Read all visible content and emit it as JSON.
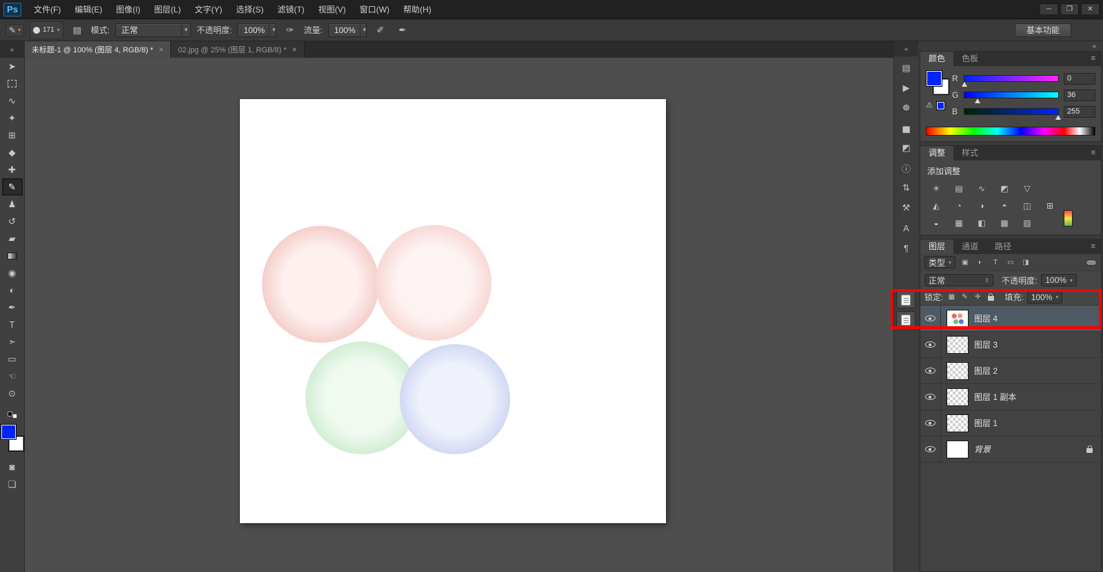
{
  "menubar": {
    "logo": "Ps",
    "items": [
      "文件(F)",
      "编辑(E)",
      "图像(I)",
      "图层(L)",
      "文字(Y)",
      "选择(S)",
      "滤镜(T)",
      "视图(V)",
      "窗口(W)",
      "帮助(H)"
    ],
    "window_controls": {
      "minimize": "─",
      "restore": "❐",
      "close": "✕"
    }
  },
  "options_bar": {
    "brush_size": "171",
    "mode_label": "模式:",
    "mode_value": "正常",
    "opacity_label": "不透明度:",
    "opacity_value": "100%",
    "flow_label": "流量:",
    "flow_value": "100%",
    "workspace_button": "基本功能"
  },
  "document_tabs": [
    {
      "title": "未标题-1 @ 100% (图层 4, RGB/8) *",
      "close": "×"
    },
    {
      "title": "02.jpg @ 25% (图层 1, RGB/8) *",
      "close": "×"
    }
  ],
  "toolbar": {
    "expand_icon": "»",
    "tools": [
      {
        "name": "move-tool",
        "glyph": "➤"
      },
      {
        "name": "rectangular-marquee-tool",
        "glyph": ""
      },
      {
        "name": "lasso-tool",
        "glyph": "∿"
      },
      {
        "name": "quick-selection-tool",
        "glyph": "✦"
      },
      {
        "name": "crop-tool",
        "glyph": "⊞"
      },
      {
        "name": "eyedropper-tool",
        "glyph": "◆"
      },
      {
        "name": "healing-brush-tool",
        "glyph": "✚"
      },
      {
        "name": "brush-tool",
        "glyph": "✎"
      },
      {
        "name": "clone-stamp-tool",
        "glyph": "♟"
      },
      {
        "name": "history-brush-tool",
        "glyph": "↺"
      },
      {
        "name": "eraser-tool",
        "glyph": "▰"
      },
      {
        "name": "gradient-tool",
        "glyph": ""
      },
      {
        "name": "blur-tool",
        "glyph": "◉"
      },
      {
        "name": "dodge-tool",
        "glyph": "◐"
      },
      {
        "name": "pen-tool",
        "glyph": "✒"
      },
      {
        "name": "type-tool",
        "glyph": "T"
      },
      {
        "name": "path-selection-tool",
        "glyph": "➣"
      },
      {
        "name": "rectangle-tool",
        "glyph": "▭"
      },
      {
        "name": "hand-tool",
        "glyph": "☜"
      },
      {
        "name": "zoom-tool",
        "glyph": "⊙"
      }
    ]
  },
  "canvas": {
    "circles": [
      {
        "name": "canvas-circle-red-left",
        "inner": "#fdf0ef",
        "mid": "#f3c9c4",
        "edge": "#dc4135"
      },
      {
        "name": "canvas-circle-red-right",
        "inner": "#fdf3f2",
        "mid": "#f6d4d0",
        "edge": "#df4a3c"
      },
      {
        "name": "canvas-circle-green",
        "inner": "#f0faf0",
        "mid": "#cdeccf",
        "edge": "#4cb254"
      },
      {
        "name": "canvas-circle-blue",
        "inner": "#eff2fc",
        "mid": "#ccd4f2",
        "edge": "#3b4cd8"
      }
    ]
  },
  "dock": {
    "strip_top_icon": "«",
    "icons": [
      {
        "name": "history-panel-icon",
        "glyph": "▤"
      },
      {
        "name": "actions-panel-icon",
        "glyph": "▶"
      },
      {
        "name": "navigator-panel-icon",
        "glyph": "☸"
      },
      {
        "name": "histogram-panel-icon",
        "glyph": "▅"
      },
      {
        "name": "properties-panel-icon",
        "glyph": "◩"
      },
      {
        "name": "info-panel-icon",
        "glyph": "ⓘ"
      },
      {
        "name": "clone-source-panel-icon",
        "glyph": "⇅"
      },
      {
        "name": "tool-presets-panel-icon",
        "glyph": "⚒"
      },
      {
        "name": "character-panel-icon",
        "glyph": "A"
      },
      {
        "name": "paragraph-panel-icon",
        "glyph": "¶"
      }
    ]
  },
  "panels_header": {
    "collapse_icon": "«",
    "menu_icon": "≡"
  },
  "color_panel": {
    "tabs": [
      "颜色",
      "色板"
    ],
    "sliders": [
      {
        "label": "R",
        "value": "0"
      },
      {
        "label": "G",
        "value": "36"
      },
      {
        "label": "B",
        "value": "255"
      }
    ],
    "warning_icon": "⚠",
    "foreground_color": "#0024ff",
    "background_color": "#ffffff"
  },
  "adjustments_panel": {
    "tabs": [
      "调整",
      "样式"
    ],
    "heading": "添加调整",
    "row1": [
      {
        "name": "brightness-contrast-icon",
        "glyph": "☀"
      },
      {
        "name": "levels-icon",
        "glyph": "▤"
      },
      {
        "name": "curves-icon",
        "glyph": "∿"
      },
      {
        "name": "exposure-icon",
        "glyph": "◩"
      },
      {
        "name": "color-lookup-icon",
        "glyph": "▽"
      }
    ],
    "row2": [
      {
        "name": "vibrance-icon",
        "glyph": "◭"
      },
      {
        "name": "hue-saturation-icon",
        "glyph": "◔"
      },
      {
        "name": "color-balance-icon",
        "glyph": "◑"
      },
      {
        "name": "black-white-icon",
        "glyph": "◓"
      },
      {
        "name": "photo-filter-icon",
        "glyph": "◫"
      },
      {
        "name": "channel-mixer-icon",
        "glyph": "⊞"
      }
    ],
    "row3": [
      {
        "name": "invert-icon",
        "glyph": "◒"
      },
      {
        "name": "posterize-icon",
        "glyph": "▦"
      },
      {
        "name": "threshold-icon",
        "glyph": "◧"
      },
      {
        "name": "gradient-map-icon",
        "glyph": "▩"
      },
      {
        "name": "selective-color-icon",
        "glyph": "▨"
      }
    ]
  },
  "layers_panel": {
    "tabs": [
      "图层",
      "通道",
      "路径"
    ],
    "filter_value": "类型",
    "filter_icons": [
      {
        "name": "filter-pixel-layers-icon",
        "glyph": "▣"
      },
      {
        "name": "filter-adjustment-layers-icon",
        "glyph": "◐"
      },
      {
        "name": "filter-type-layers-icon",
        "glyph": "T"
      },
      {
        "name": "filter-shape-layers-icon",
        "glyph": "▭"
      },
      {
        "name": "filter-smart-objects-icon",
        "glyph": "◨"
      }
    ],
    "blend_mode": "正常",
    "opacity_label": "不透明度:",
    "opacity_value": "100%",
    "lock_label": "锁定:",
    "lock_icons": [
      {
        "name": "lock-transparent-pixels-icon",
        "glyph": "▦"
      },
      {
        "name": "lock-image-pixels-icon",
        "glyph": "✎"
      },
      {
        "name": "lock-position-icon",
        "glyph": "✛"
      }
    ],
    "fill_label": "填充:",
    "fill_value": "100%",
    "layers": [
      {
        "name": "图层 4",
        "selected": true,
        "locked": false
      },
      {
        "name": "图层 3",
        "selected": false,
        "locked": false
      },
      {
        "name": "图层 2",
        "selected": false,
        "locked": false
      },
      {
        "name": "图层 1 副本",
        "selected": false,
        "locked": false
      },
      {
        "name": "图层 1",
        "selected": false,
        "locked": false
      },
      {
        "name": "背景",
        "selected": false,
        "locked": true
      }
    ]
  },
  "annotation": {
    "color": "#ff0000"
  }
}
